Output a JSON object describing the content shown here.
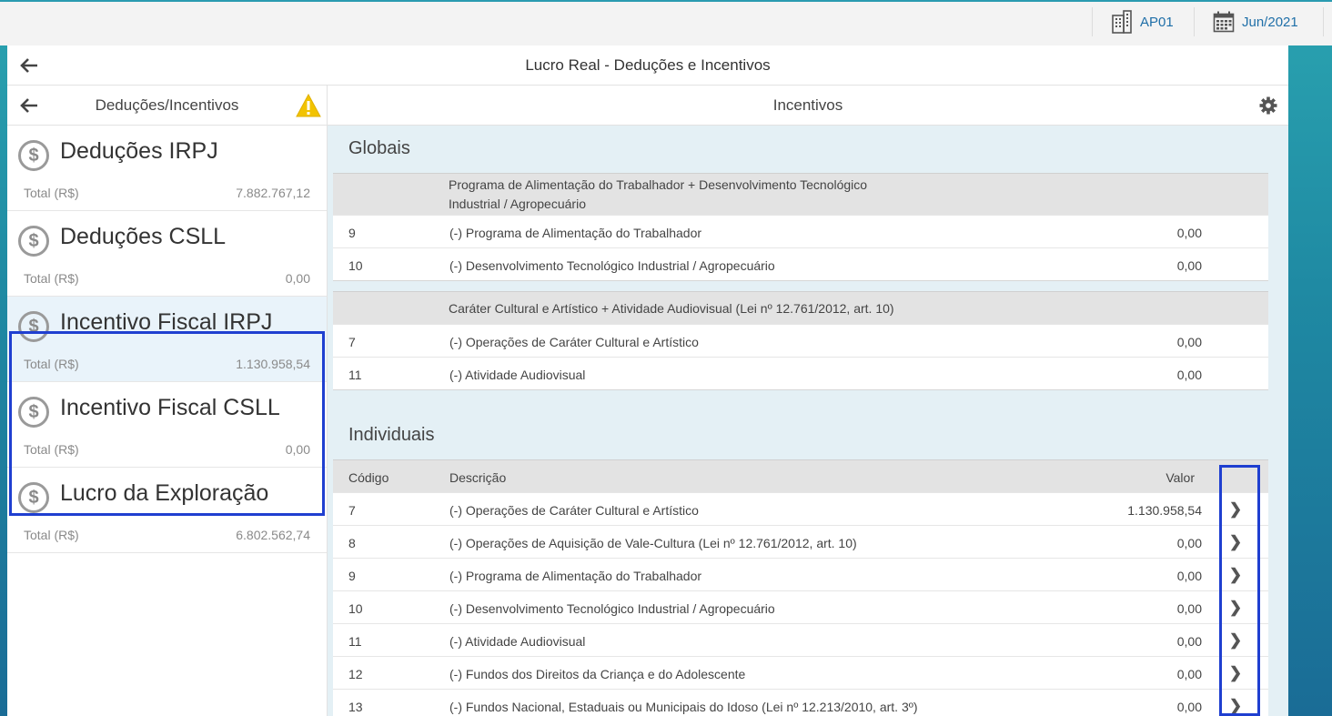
{
  "topbar": {
    "company": "AP01",
    "period": "Jun/2021"
  },
  "app": {
    "title": "Lucro Real - Deduções e Incentivos"
  },
  "sidebar": {
    "title": "Deduções/Incentivos",
    "items": [
      {
        "title": "Deduções IRPJ",
        "total_label": "Total (R$)",
        "total": "7.882.767,12",
        "active": false
      },
      {
        "title": "Deduções CSLL",
        "total_label": "Total (R$)",
        "total": "0,00",
        "active": false
      },
      {
        "title": "Incentivo Fiscal IRPJ",
        "total_label": "Total (R$)",
        "total": "1.130.958,54",
        "active": true
      },
      {
        "title": "Incentivo Fiscal CSLL",
        "total_label": "Total (R$)",
        "total": "0,00",
        "active": false
      },
      {
        "title": "Lucro da Exploração",
        "total_label": "Total (R$)",
        "total": "6.802.562,74",
        "active": false
      }
    ]
  },
  "main": {
    "title": "Incentivos",
    "globais": {
      "title": "Globais",
      "groups": [
        {
          "header_line1": "Programa de Alimentação do Trabalhador + Desenvolvimento Tecnológico",
          "header_line2": "Industrial / Agropecuário",
          "rows": [
            {
              "code": "9",
              "desc": "(-) Programa de Alimentação do Trabalhador",
              "value": "0,00"
            },
            {
              "code": "10",
              "desc": "(-) Desenvolvimento Tecnológico Industrial / Agropecuário",
              "value": "0,00"
            }
          ]
        },
        {
          "header_line1": "Caráter Cultural e Artístico + Atividade Audiovisual (Lei nº 12.761/2012, art. 10)",
          "rows": [
            {
              "code": "7",
              "desc": "(-) Operações de Caráter Cultural e Artístico",
              "value": "0,00"
            },
            {
              "code": "11",
              "desc": "(-) Atividade Audiovisual",
              "value": "0,00"
            }
          ]
        }
      ]
    },
    "individuais": {
      "title": "Individuais",
      "columns": {
        "code": "Código",
        "desc": "Descrição",
        "value": "Valor"
      },
      "rows": [
        {
          "code": "7",
          "desc": "(-) Operações de Caráter Cultural e Artístico",
          "value": "1.130.958,54"
        },
        {
          "code": "8",
          "desc": "(-) Operações de Aquisição de Vale-Cultura (Lei nº 12.761/2012, art. 10)",
          "value": "0,00"
        },
        {
          "code": "9",
          "desc": "(-) Programa de Alimentação do Trabalhador",
          "value": "0,00"
        },
        {
          "code": "10",
          "desc": "(-) Desenvolvimento Tecnológico Industrial / Agropecuário",
          "value": "0,00"
        },
        {
          "code": "11",
          "desc": "(-) Atividade Audiovisual",
          "value": "0,00"
        },
        {
          "code": "12",
          "desc": "(-) Fundos dos Direitos da Criança e do Adolescente",
          "value": "0,00"
        },
        {
          "code": "13",
          "desc": "(-) Fundos Nacional, Estaduais ou Municipais do Idoso (Lei nº 12.213/2010, art. 3º)",
          "value": "0,00"
        }
      ]
    }
  },
  "icons": {
    "back": "arrow-left-icon",
    "warning": "warning-icon",
    "settings": "gear-icon",
    "company": "building-icon",
    "calendar": "calendar-icon",
    "coin": "dollar-coin-icon",
    "chevron": "chevron-right-icon"
  },
  "colors": {
    "accent": "#1f6fa8",
    "active_item_bg": "#e9f3fa",
    "highlight_border": "#1f3fd0",
    "warning": "#f2c300"
  }
}
